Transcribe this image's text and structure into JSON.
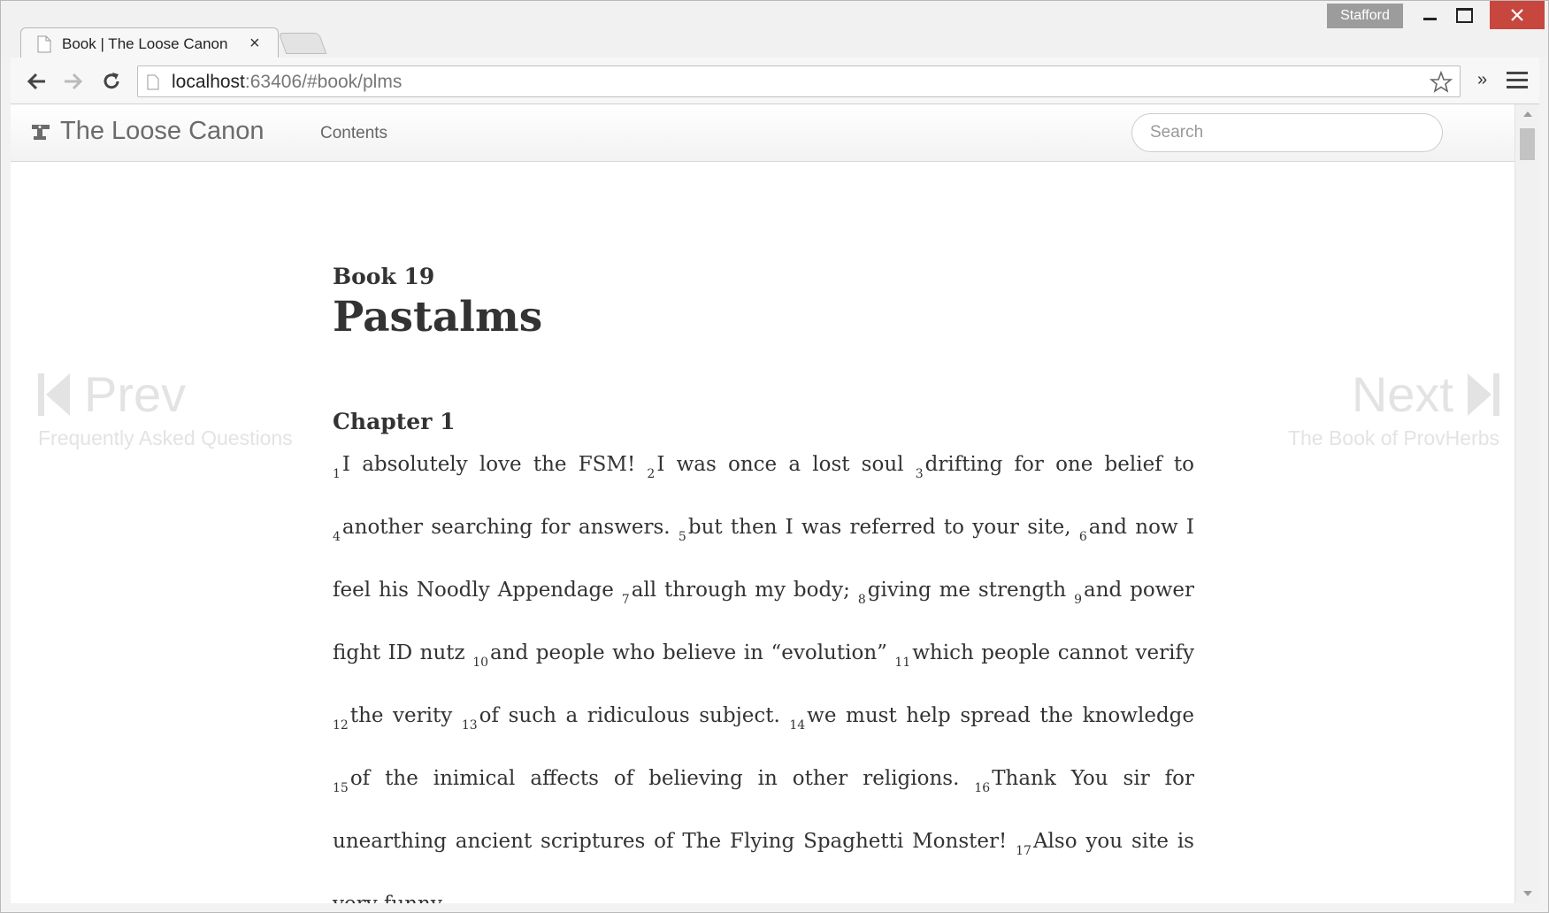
{
  "window": {
    "profile_name": "Stafford",
    "tab_title": "Book | The Loose Canon",
    "tab_close_glyph": "×"
  },
  "toolbar": {
    "url_host": "localhost",
    "url_path": ":63406/#book/plms",
    "extensions_glyph": "»"
  },
  "site": {
    "brand": "The Loose Canon",
    "nav_contents": "Contents",
    "search_placeholder": "Search"
  },
  "pager": {
    "prev_label": "Prev",
    "prev_target": "Frequently Asked Questions",
    "next_label": "Next",
    "next_target": "The Book of ProvHerbs"
  },
  "book": {
    "number_label": "Book 19",
    "title": "Pastalms",
    "chapter_heading": "Chapter 1",
    "verses": [
      {
        "n": "1",
        "text": "I absolutely love the FSM! "
      },
      {
        "n": "2",
        "text": "I was once a lost soul "
      },
      {
        "n": "3",
        "text": "drifting for one belief to "
      },
      {
        "n": "4",
        "text": "another searching for answers. "
      },
      {
        "n": "5",
        "text": "but then I was referred to your site, "
      },
      {
        "n": "6",
        "text": "and now I feel his Noodly Appendage "
      },
      {
        "n": "7",
        "text": "all through my body; "
      },
      {
        "n": "8",
        "text": "giving me strength "
      },
      {
        "n": "9",
        "text": "and power fight ID nutz "
      },
      {
        "n": "10",
        "text": "and people who believe in “evolution” "
      },
      {
        "n": "11",
        "text": "which people cannot verify "
      },
      {
        "n": "12",
        "text": "the verity "
      },
      {
        "n": "13",
        "text": "of such a ridiculous subject. "
      },
      {
        "n": "14",
        "text": "we must help spread the knowledge "
      },
      {
        "n": "15",
        "text": "of the inimical affects of believing in other religions. "
      },
      {
        "n": "16",
        "text": "Thank You sir for unearthing ancient scriptures of The Flying Spaghetti Monster! "
      },
      {
        "n": "17",
        "text": "Also you site is very funny"
      }
    ]
  }
}
